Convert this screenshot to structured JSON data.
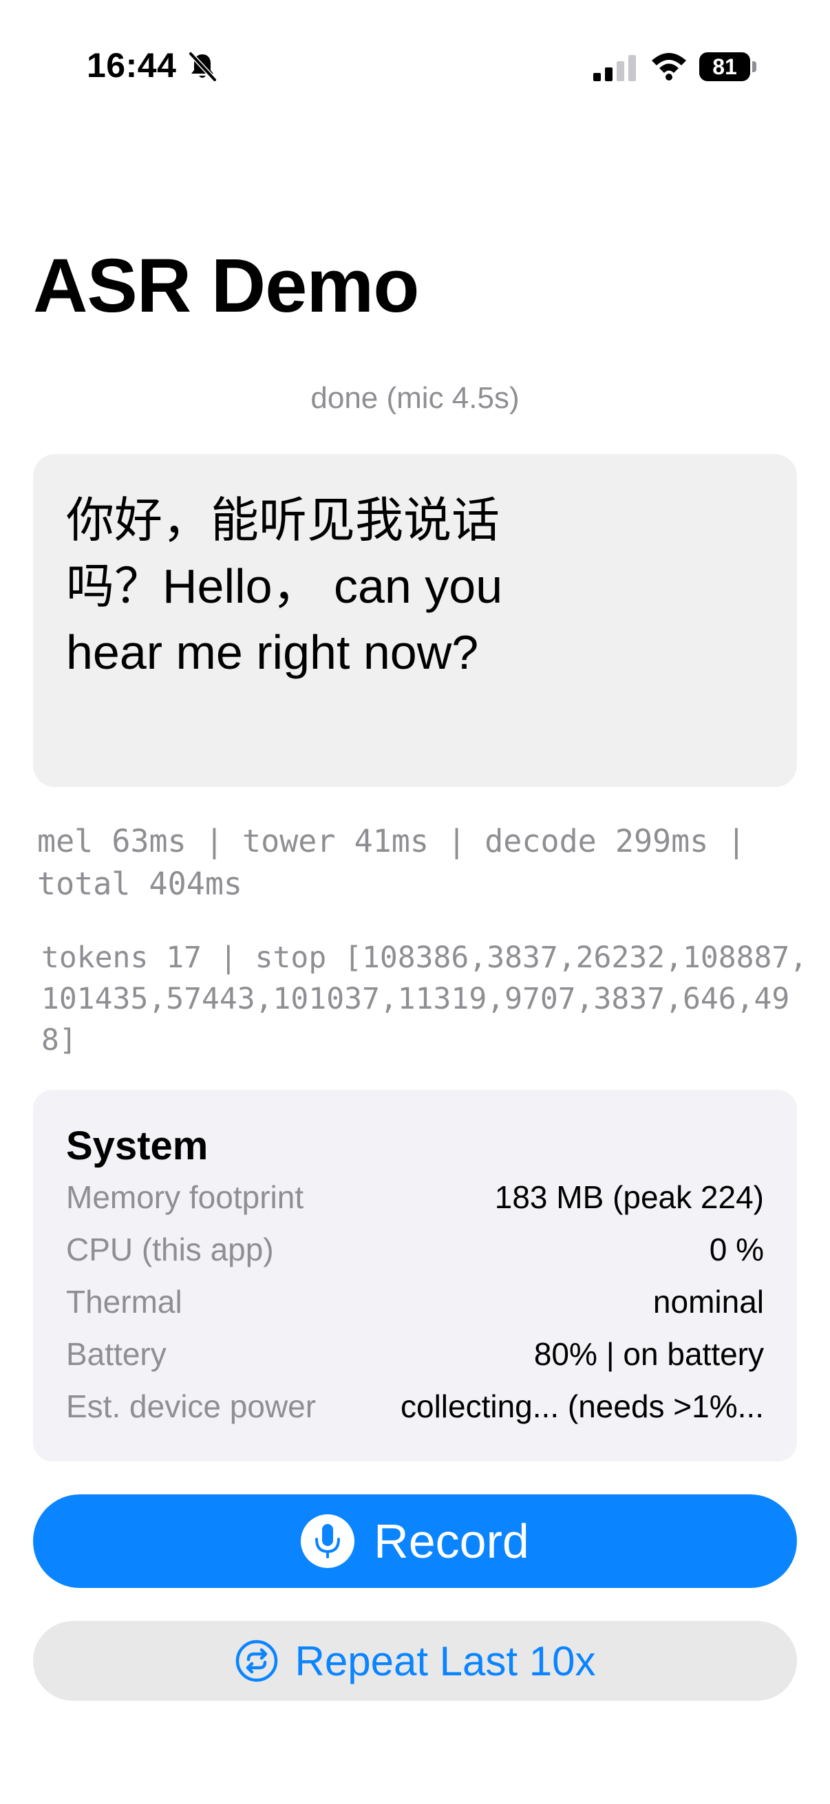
{
  "status_bar": {
    "time": "16:44",
    "battery_level": "81"
  },
  "page": {
    "title": "ASR Demo",
    "status": "done (mic 4.5s)"
  },
  "transcript": {
    "text": "你好，能听见我说话吗？Hello， can you hear me right now?"
  },
  "stats": {
    "timing": "mel 63ms | tower 41ms | decode 299ms | total 404ms",
    "tokens": "tokens 17 | stop [108386,3837,26232,108887,101435,57443,101037,11319,9707,3837,646,498]"
  },
  "system": {
    "title": "System",
    "rows": [
      {
        "label": "Memory footprint",
        "value": "183 MB (peak 224)"
      },
      {
        "label": "CPU (this app)",
        "value": "0 %"
      },
      {
        "label": "Thermal",
        "value": "nominal"
      },
      {
        "label": "Battery",
        "value": "80% | on battery"
      },
      {
        "label": "Est. device power",
        "value": "collecting... (needs >1%..."
      }
    ]
  },
  "actions": {
    "record_label": "Record",
    "repeat_label": "Repeat Last 10x"
  },
  "colors": {
    "accent": "#0a84ff",
    "secondary_text": "#8e8e93",
    "card_background": "#f0f0f0"
  },
  "icons": {
    "mute": "bell-slash-icon",
    "signal": "cellular-signal-icon",
    "wifi": "wifi-icon",
    "battery": "battery-icon",
    "record": "microphone-icon",
    "repeat": "repeat-icon"
  }
}
